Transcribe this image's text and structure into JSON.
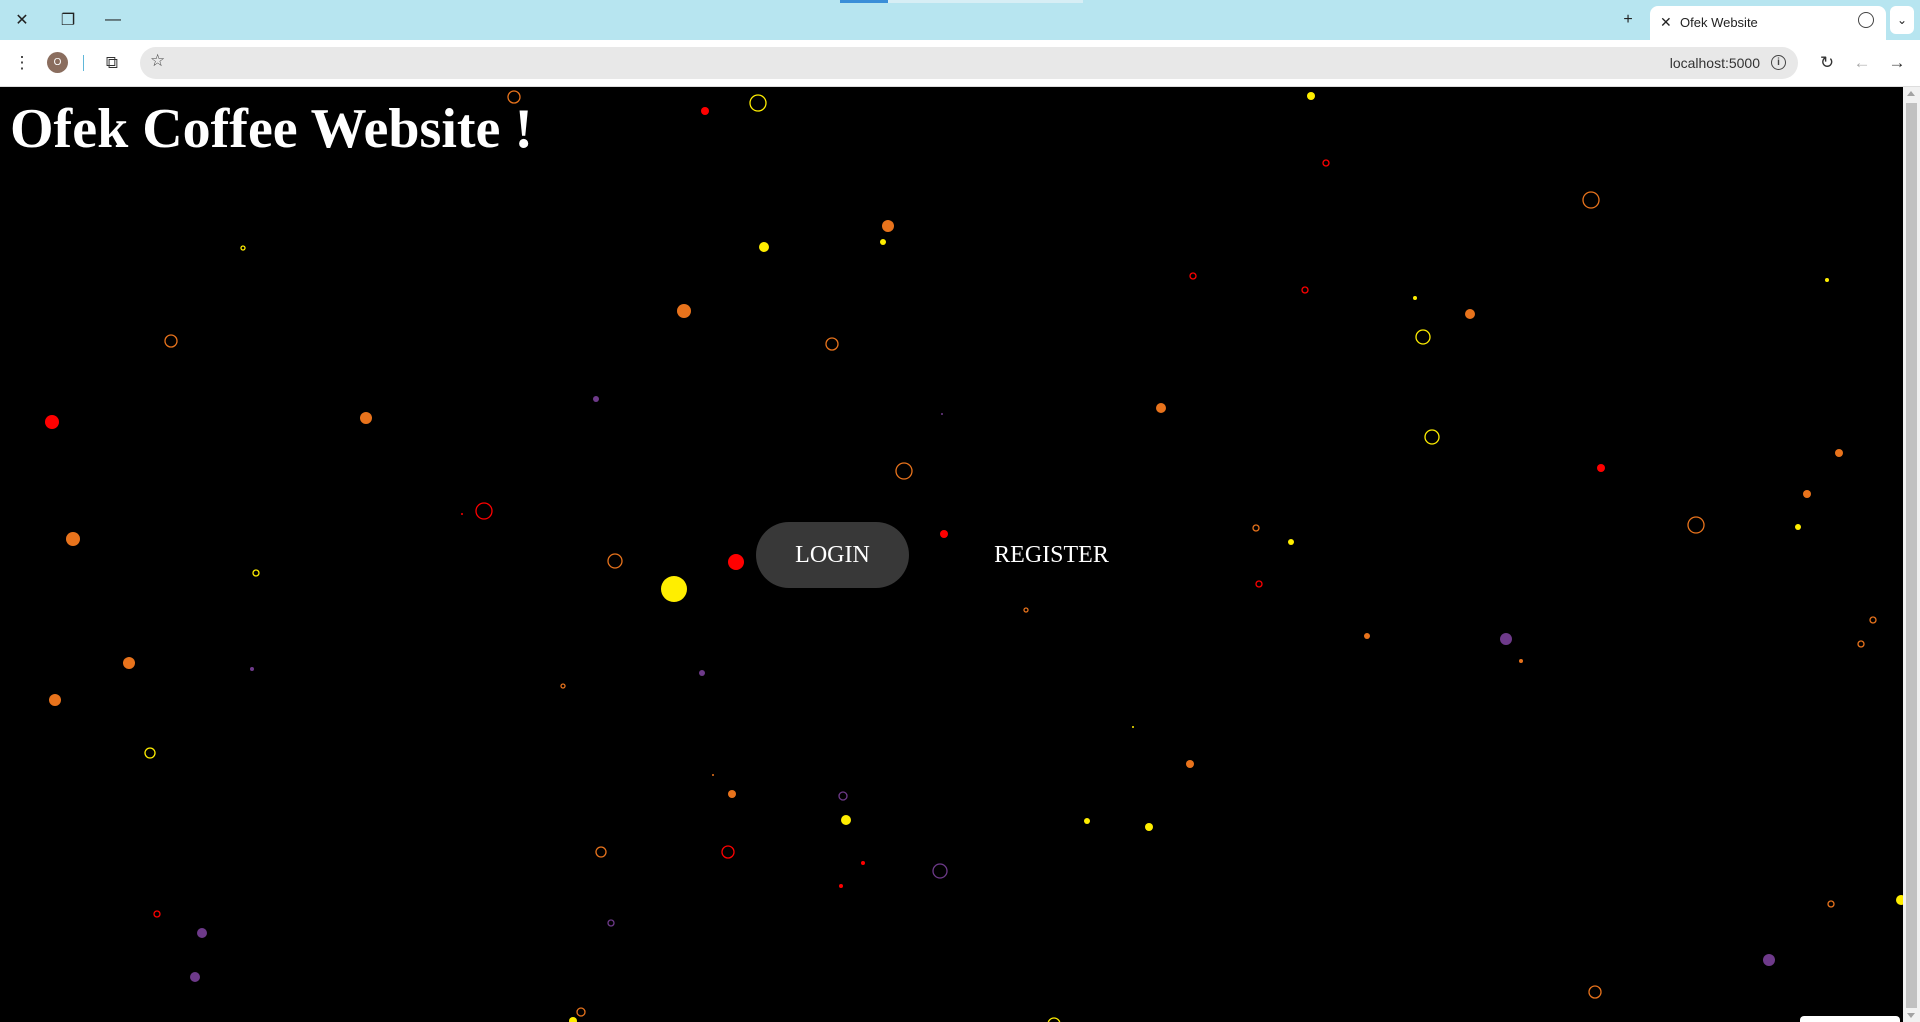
{
  "browser": {
    "tab_title": "Ofek Website",
    "profile_initial": "O",
    "url": "localhost:5000",
    "icons": [
      "close-icon",
      "restore-icon",
      "minimize-icon",
      "new-tab-icon",
      "globe-icon",
      "tab-menu-icon",
      "menu-icon",
      "extensions-icon",
      "bookmark-star-icon",
      "site-info-icon",
      "reload-icon",
      "back-icon",
      "forward-icon"
    ]
  },
  "page": {
    "title": "Ofek Coffee Website !",
    "login_label": "LOGIN",
    "register_label": "REGISTER",
    "colors": {
      "background": "#000000",
      "button_bg": "#383838",
      "text": "#ffffff"
    },
    "particle_colors": {
      "red": "#ff0000",
      "orange": "#e8731c",
      "yellow": "#ffee00",
      "purple": "#6e3a8a"
    }
  }
}
